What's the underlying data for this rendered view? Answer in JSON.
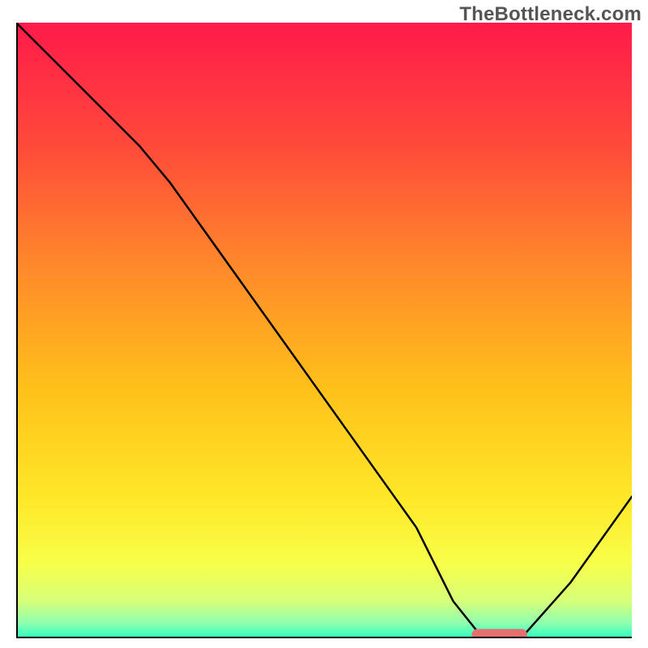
{
  "watermark": "TheBottleneck.com",
  "chart_data": {
    "type": "line",
    "title": "",
    "xlabel": "",
    "ylabel": "",
    "xlim": [
      0,
      100
    ],
    "ylim": [
      0,
      100
    ],
    "x": [
      0,
      10,
      20,
      25,
      35,
      45,
      55,
      65,
      71,
      75,
      80,
      82,
      90,
      100
    ],
    "values": [
      100,
      90,
      80,
      74,
      60,
      46,
      32,
      18,
      6,
      1,
      0,
      0,
      9,
      23
    ],
    "optimum_x_range": [
      74,
      83
    ],
    "optimum_y": 0.6
  },
  "colors": {
    "gradient_stops": [
      {
        "offset": 0.0,
        "color": "#ff1a4a"
      },
      {
        "offset": 0.2,
        "color": "#ff4a3a"
      },
      {
        "offset": 0.4,
        "color": "#ff8a2a"
      },
      {
        "offset": 0.6,
        "color": "#ffc21a"
      },
      {
        "offset": 0.78,
        "color": "#ffe92a"
      },
      {
        "offset": 0.88,
        "color": "#f7ff4a"
      },
      {
        "offset": 0.94,
        "color": "#d6ff7a"
      },
      {
        "offset": 0.975,
        "color": "#8fffb0"
      },
      {
        "offset": 1.0,
        "color": "#2affc0"
      }
    ],
    "marker": "#e36f6f",
    "curve": "#000000",
    "axis": "#000000"
  }
}
